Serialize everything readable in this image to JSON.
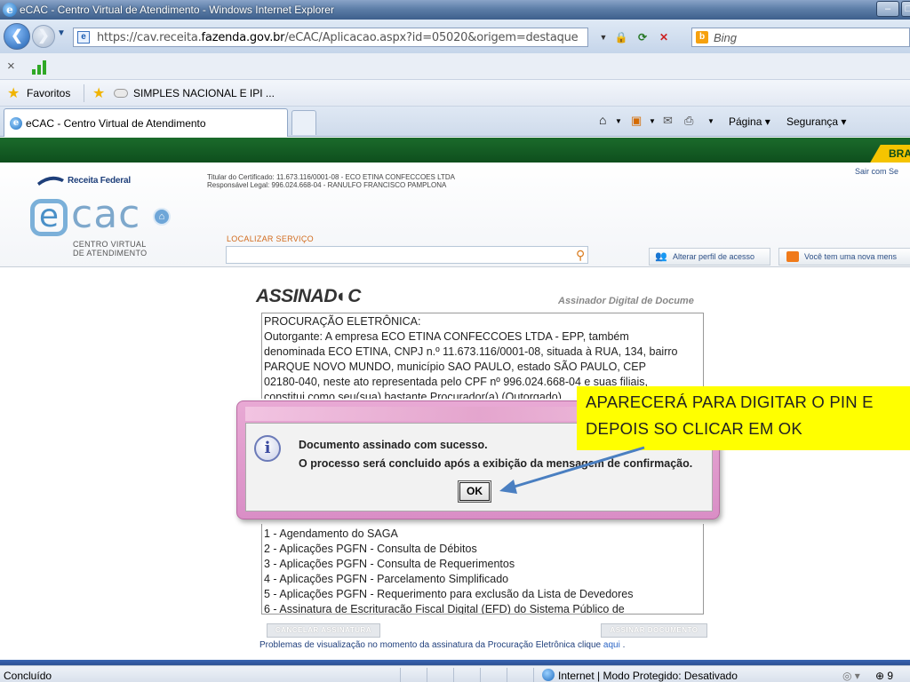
{
  "window": {
    "title": "eCAC - Centro Virtual de Atendimento - Windows Internet Explorer",
    "minimize": "–",
    "maximize": "□"
  },
  "address": {
    "url_prefix": "https://cav.receita.",
    "url_domain": "fazenda.gov.br",
    "url_path": "/eCAC/Aplicacao.aspx?id=05020&origem=destaque",
    "search_placeholder": "Bing"
  },
  "favorites": {
    "label": "Favoritos",
    "link": "SIMPLES NACIONAL E IPI ..."
  },
  "tab": {
    "label": "eCAC - Centro Virtual de Atendimento"
  },
  "command_bar": {
    "pagina": "Página ▾",
    "seguranca": "Segurança ▾"
  },
  "banner": {
    "bra": "BRA"
  },
  "ecac": {
    "receita": "Receita Federal",
    "logo_e": "e",
    "logo_cac": "cac",
    "sub1": "CENTRO VIRTUAL",
    "sub2": "DE ATENDIMENTO",
    "titular": "Titular do Certificado: 11.673.116/0001-08 - ECO ETINA CONFECCOES LTDA",
    "responsavel": "Responsável Legal: 996.024.668-04 - RANULFO FRANCISCO PAMPLONA",
    "sair": "Sair com Se",
    "localizar": "LOCALIZAR SERVIÇO",
    "perfil": "Alterar perfil de acesso",
    "mensagem": "Você tem uma nova mens"
  },
  "document": {
    "logo": "ASSINAD◐C",
    "logo_sub": "Assinador Digital de Docume",
    "lines": [
      "PROCURAÇÃO ELETRÔNICA:",
      "Outorgante: A empresa ECO ETINA CONFECCOES LTDA - EPP, também",
      "denominada ECO ETINA, CNPJ n.º 11.673.116/0001-08, situada à RUA, 134, bairro",
      "PARQUE NOVO MUNDO, município SAO PAULO, estado SÃO PAULO, CEP",
      "02180-040, neste ato representada pelo CPF nº 996.024.668-04 e suas filiais,",
      "constitui como seu(sua) bastante Procurador(a) (Outorgado)"
    ],
    "list": [
      "1 - Agendamento do SAGA",
      "2 - Aplicações PGFN - Consulta de Débitos",
      "3 - Aplicações PGFN - Consulta de Requerimentos",
      "4 - Aplicações PGFN - Parcelamento Simplificado",
      "5 - Aplicações PGFN - Requerimento para exclusão da Lista de Devedores",
      "6 - Assinatura de Escrituracão Fiscal Digital (EFD) do Sistema Público de"
    ],
    "cancelar": "CANCELAR ASSINATURA",
    "assinar": "ASSINAR DOCUMENTO",
    "problemas": "Problemas de visualização no momento da assinatura da Procuração Eletrônica clique",
    "aqui": "aqui",
    "dot": "."
  },
  "dialog": {
    "line1": "Documento assinado com sucesso.",
    "line2": "O processo será concluido após a exibição da mensagem de confirmação.",
    "ok": "OK"
  },
  "callout": {
    "line1": "APARECERÁ PARA DIGITAR O PIN E",
    "line2": "DEPOIS SO CLICAR EM OK"
  },
  "status": {
    "text": "Concluído",
    "zone": "Internet | Modo Protegido: Desativado",
    "zoom": "⊕ 9"
  },
  "colors": {
    "accent_green": "#1b6b2b",
    "callout_yellow": "#ffff00",
    "dialog_pink": "#e8a9d4",
    "arrow_blue": "#4a7fc1"
  }
}
